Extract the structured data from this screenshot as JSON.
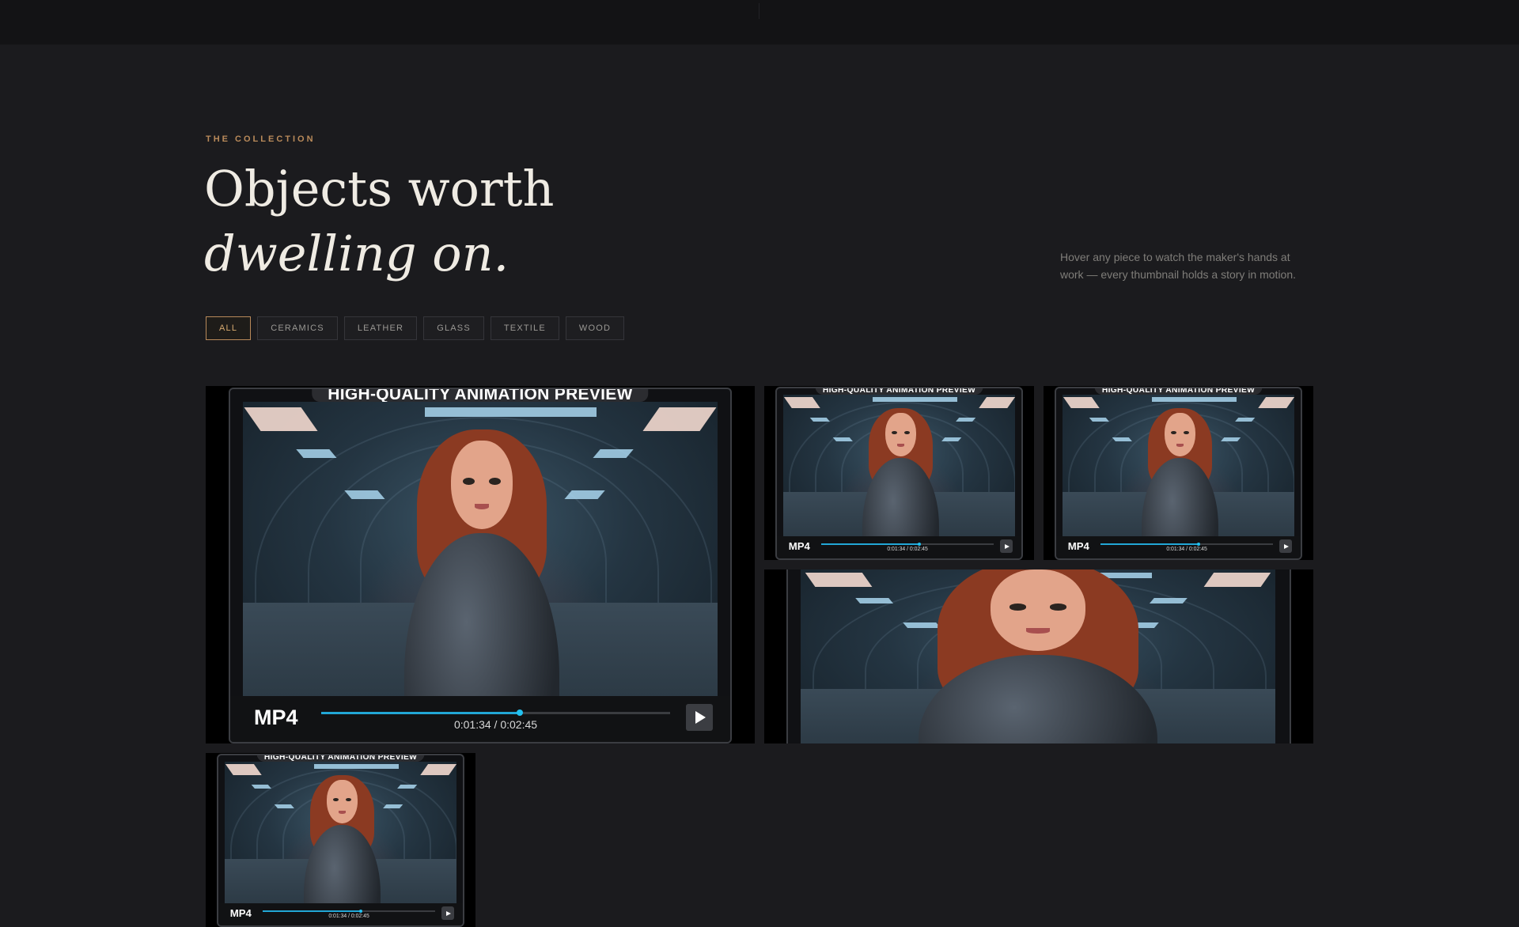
{
  "header": {
    "eyebrow": "THE COLLECTION"
  },
  "hero": {
    "title_line1": "Objects worth",
    "title_line2": "dwelling on.",
    "lede": "Hover any piece to watch the maker's hands at work — every thumbnail holds a story in motion."
  },
  "filters": [
    "ALL",
    "CERAMICS",
    "LEATHER",
    "GLASS",
    "TEXTILE",
    "WOOD"
  ],
  "active_filter": "ALL",
  "thumb": {
    "banner": "HIGH-QUALITY ANIMATION PREVIEW",
    "format": "MP4",
    "time": "0:01:34 / 0:02:45",
    "progress": 0.57
  },
  "colors": {
    "accent": "#b98a5a",
    "progress": "#22a7d6",
    "background": "#1b1b1e"
  },
  "icons": [
    "play-icon"
  ]
}
